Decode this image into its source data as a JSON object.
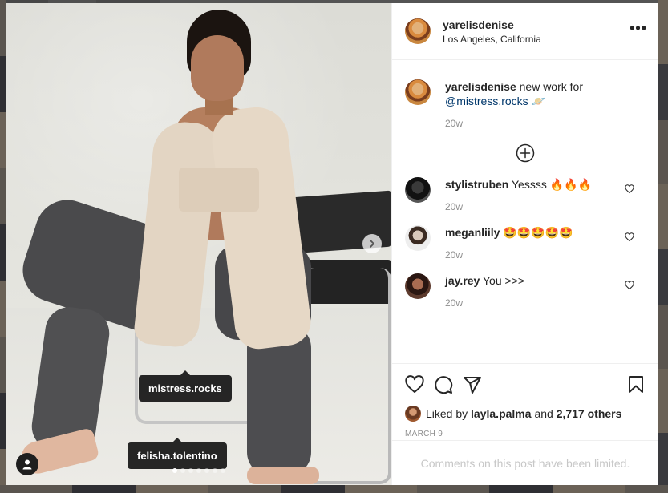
{
  "post": {
    "author": "yarelisdenise",
    "location": "Los Angeles, California",
    "more_label": "•••",
    "caption": {
      "author": "yarelisdenise",
      "text": "new work for",
      "mention": "@mistress.rocks",
      "emoji": "🪐",
      "time": "20w"
    },
    "photo_tags": [
      {
        "label": "mistress.rocks"
      },
      {
        "label": "felisha.tolentino"
      }
    ],
    "carousel": {
      "count": 7,
      "active_index": 0
    }
  },
  "comments": [
    {
      "user": "stylistruben",
      "text": "Yessss 🔥🔥🔥",
      "time": "20w"
    },
    {
      "user": "meganliily",
      "text": "🤩🤩🤩🤩🤩",
      "time": "20w"
    },
    {
      "user": "jay.rey",
      "text": "You >>>",
      "time": "20w"
    }
  ],
  "likes": {
    "prefix": "Liked by",
    "user": "layla.palma",
    "and": "and",
    "others": "2,717 others"
  },
  "date": "MARCH 9",
  "comments_limited": "Comments on this post have been limited.",
  "colors": {
    "text": "#262626",
    "muted": "#8e8e8e",
    "link": "#00376b",
    "border": "#efefef",
    "tag_bg": "#0a0a0a"
  },
  "icons": {
    "like": "heart-icon",
    "comment": "comment-bubble-icon",
    "share": "paper-plane-icon",
    "save": "bookmark-icon",
    "load_more": "plus-circle-icon",
    "next": "chevron-right-icon",
    "user_tags": "person-icon",
    "more": "more-horizontal-icon"
  }
}
